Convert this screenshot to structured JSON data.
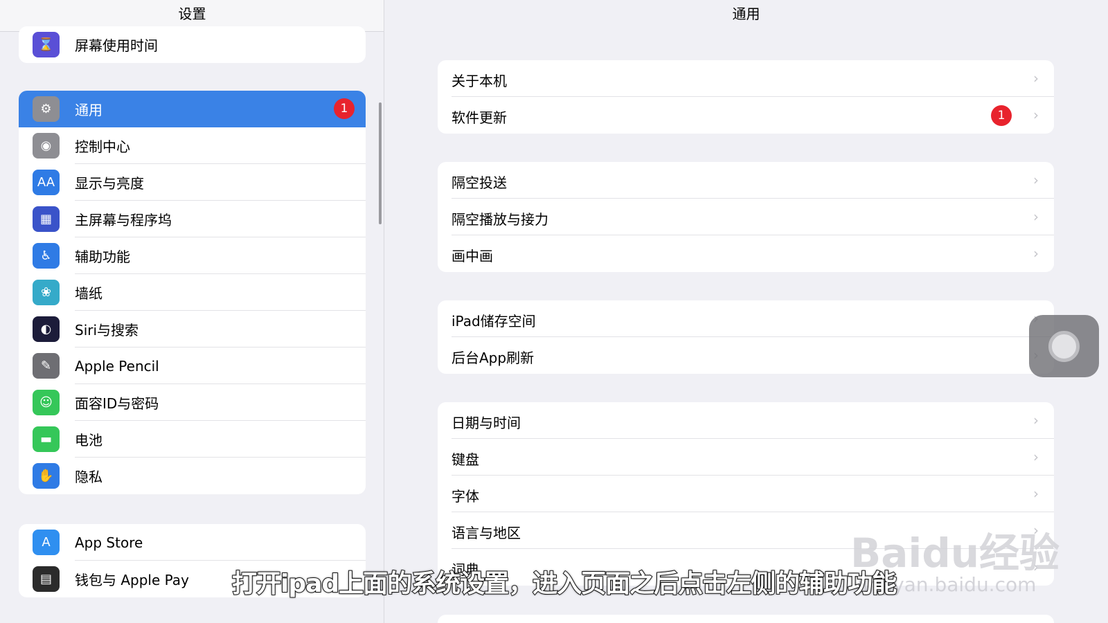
{
  "sidebar": {
    "title": "设置",
    "group1": [
      {
        "label": "屏幕使用时间",
        "icon": "hourglass-icon",
        "color": "#5a4fd6",
        "glyph": "⌛"
      }
    ],
    "group2": [
      {
        "label": "通用",
        "icon": "gear-icon",
        "color": "#8e8e93",
        "glyph": "⚙",
        "badge": "1",
        "selected": true
      },
      {
        "label": "控制中心",
        "icon": "toggles-icon",
        "color": "#8e8e93",
        "glyph": "◉"
      },
      {
        "label": "显示与亮度",
        "icon": "text-size-icon",
        "color": "#2f7be5",
        "glyph": "AA"
      },
      {
        "label": "主屏幕与程序坞",
        "icon": "home-grid-icon",
        "color": "#3a53c9",
        "glyph": "▦"
      },
      {
        "label": "辅助功能",
        "icon": "accessibility-icon",
        "color": "#2f7be5",
        "glyph": "♿"
      },
      {
        "label": "墙纸",
        "icon": "wallpaper-flower-icon",
        "color": "#35aac9",
        "glyph": "❀"
      },
      {
        "label": "Siri与搜索",
        "icon": "siri-icon",
        "color": "#1c1c3a",
        "glyph": "◐"
      },
      {
        "label": "Apple Pencil",
        "icon": "pencil-icon",
        "color": "#6e6e73",
        "glyph": "✎"
      },
      {
        "label": "面容ID与密码",
        "icon": "face-id-icon",
        "color": "#35c759",
        "glyph": "☺"
      },
      {
        "label": "电池",
        "icon": "battery-icon",
        "color": "#35c759",
        "glyph": "▬"
      },
      {
        "label": "隐私",
        "icon": "hand-icon",
        "color": "#2f7be5",
        "glyph": "✋"
      }
    ],
    "group3": [
      {
        "label": "App Store",
        "icon": "app-store-icon",
        "color": "#2f8ff0",
        "glyph": "A"
      },
      {
        "label": "钱包与 Apple Pay",
        "icon": "wallet-icon",
        "color": "#2b2b2b",
        "glyph": "▤"
      }
    ]
  },
  "main": {
    "title": "通用",
    "groups": [
      [
        {
          "label": "关于本机"
        },
        {
          "label": "软件更新",
          "badge": "1"
        }
      ],
      [
        {
          "label": "隔空投送"
        },
        {
          "label": "隔空播放与接力"
        },
        {
          "label": "画中画"
        }
      ],
      [
        {
          "label": "iPad储存空间"
        },
        {
          "label": "后台App刷新"
        }
      ],
      [
        {
          "label": "日期与时间"
        },
        {
          "label": "键盘"
        },
        {
          "label": "字体"
        },
        {
          "label": "语言与地区"
        },
        {
          "label": "词典"
        }
      ]
    ],
    "chevron": "›"
  },
  "overlay": {
    "subtitle": "打开ipad上面的系统设置，进入页面之后点击左侧的辅助功能",
    "watermark": "Baidu经验",
    "watermark_url": "jingyan.baidu.com"
  }
}
